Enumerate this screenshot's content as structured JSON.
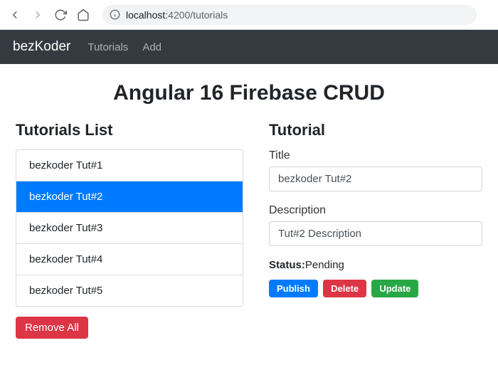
{
  "browser": {
    "url_host": "localhost:",
    "url_port_path": "4200/tutorials"
  },
  "navbar": {
    "brand": "bezKoder",
    "links": [
      "Tutorials",
      "Add"
    ]
  },
  "page_title": "Angular 16 Firebase CRUD",
  "left": {
    "heading": "Tutorials List",
    "items": [
      {
        "label": "bezkoder Tut#1",
        "active": false
      },
      {
        "label": "bezkoder Tut#2",
        "active": true
      },
      {
        "label": "bezkoder Tut#3",
        "active": false
      },
      {
        "label": "bezkoder Tut#4",
        "active": false
      },
      {
        "label": "bezkoder Tut#5",
        "active": false
      }
    ],
    "remove_all": "Remove All"
  },
  "right": {
    "heading": "Tutorial",
    "title_label": "Title",
    "title_value": "bezkoder Tut#2",
    "desc_label": "Description",
    "desc_value": "Tut#2 Description",
    "status_label": "Status:",
    "status_value": "Pending",
    "publish": "Publish",
    "delete": "Delete",
    "update": "Update"
  }
}
